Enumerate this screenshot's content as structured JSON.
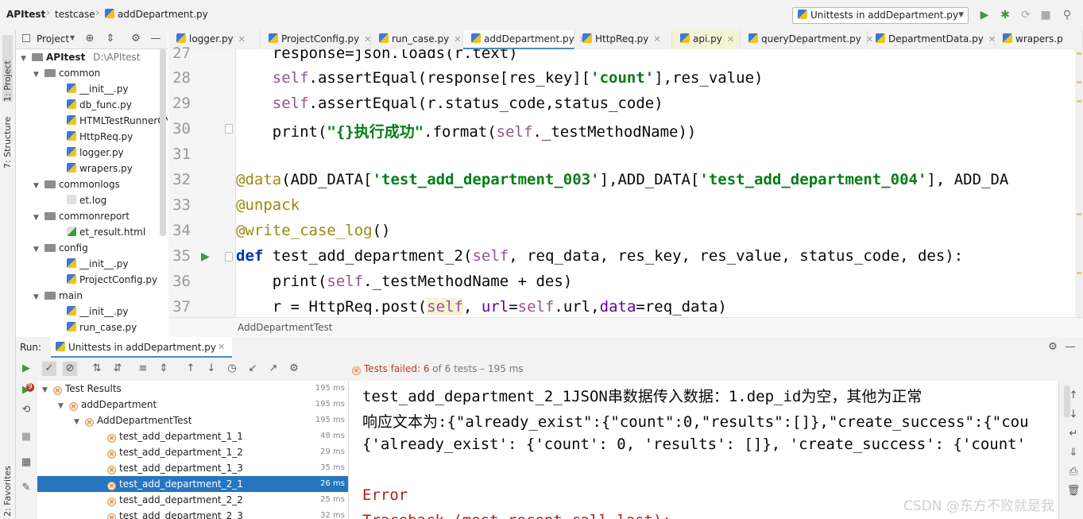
{
  "navbar": {
    "project": "APItest",
    "folder": "testcase",
    "file": "addDepartment.py",
    "run_config": "Unittests in addDepartment.py"
  },
  "left_strip": {
    "project_label": "1: Project",
    "structure_label": "7: Structure",
    "favorites_label": "2: Favorites"
  },
  "project_panel": {
    "title": "Project",
    "root": "APItest",
    "root_path": "D:\\APItest",
    "items": [
      {
        "label": "common",
        "kind": "folder"
      },
      {
        "label": "__init__.py",
        "kind": "file"
      },
      {
        "label": "db_func.py",
        "kind": "file"
      },
      {
        "label": "HTMLTestRunnerCN",
        "kind": "file"
      },
      {
        "label": "HttpReq.py",
        "kind": "file"
      },
      {
        "label": "logger.py",
        "kind": "file"
      },
      {
        "label": "wrapers.py",
        "kind": "file"
      },
      {
        "label": "commonlogs",
        "kind": "folder"
      },
      {
        "label": "et.log",
        "kind": "file"
      },
      {
        "label": "commonreport",
        "kind": "folder"
      },
      {
        "label": "et_result.html",
        "kind": "file"
      },
      {
        "label": "config",
        "kind": "folder"
      },
      {
        "label": "__init__.py",
        "kind": "file"
      },
      {
        "label": "ProjectConfig.py",
        "kind": "file"
      },
      {
        "label": "main",
        "kind": "folder"
      },
      {
        "label": "__init__.py",
        "kind": "file"
      },
      {
        "label": "run_case.py",
        "kind": "file"
      }
    ]
  },
  "editor_tabs": [
    "logger.py",
    "ProjectConfig.py",
    "run_case.py",
    "addDepartment.py",
    "HttpReq.py",
    "api.py",
    "queryDepartment.py",
    "DepartmentData.py",
    "wrapers.p"
  ],
  "editor": {
    "line_numbers": [
      "27",
      "28",
      "29",
      "30",
      "31",
      "32",
      "33",
      "34",
      "35",
      "36",
      "37"
    ],
    "lines": [
      "        response=json.loads(r.text)",
      "        self.assertEqual(response[res_key]['count'],res_value)",
      "        self.assertEqual(r.status_code,status_code)",
      "        print(\"{}执行成功\".format(self._testMethodName))",
      "",
      "    @data(ADD_DATA['test_add_department_003'],ADD_DATA['test_add_department_004'], ADD_DA",
      "    @unpack",
      "    @write_case_log()",
      "    def test_add_department_2(self, req_data, res_key, res_value, status_code, des):",
      "        print(self._testMethodName + des)",
      "        r = HttpReq.post(self, url=self.url,data=req_data)"
    ],
    "breadcrumb": "AddDepartmentTest"
  },
  "run_panel": {
    "label": "Run:",
    "tab": "Unittests in addDepartment.py",
    "status_prefix": "Tests failed: ",
    "status_count": "6",
    "status_suffix": " of 6 tests – 195 ms",
    "badge_count": "9",
    "tests": [
      {
        "label": "Test Results",
        "time": "195 ms",
        "depth": 0
      },
      {
        "label": "addDepartment",
        "time": "195 ms",
        "depth": 1
      },
      {
        "label": "AddDepartmentTest",
        "time": "195 ms",
        "depth": 2
      },
      {
        "label": "test_add_department_1_1",
        "time": "48 ms",
        "depth": 3
      },
      {
        "label": "test_add_department_1_2",
        "time": "29 ms",
        "depth": 3
      },
      {
        "label": "test_add_department_1_3",
        "time": "35 ms",
        "depth": 3
      },
      {
        "label": "test_add_department_2_1",
        "time": "26 ms",
        "depth": 3,
        "selected": true
      },
      {
        "label": "test_add_department_2_2",
        "time": "25 ms",
        "depth": 3
      },
      {
        "label": "test_add_department_2_3",
        "time": "32 ms",
        "depth": 3
      }
    ],
    "console": [
      "test_add_department_2_1JSON串数据传入数据：1.dep_id为空，其他为正常",
      "响应文本为:{\"already_exist\":{\"count\":0,\"results\":[]},\"create_success\":{\"cou",
      "{'already_exist': {'count': 0, 'results': []}, 'create_success': {'count'",
      "",
      "Error",
      "Traceback (most recent call last):"
    ]
  },
  "watermark": "CSDN @东方不败就是我"
}
